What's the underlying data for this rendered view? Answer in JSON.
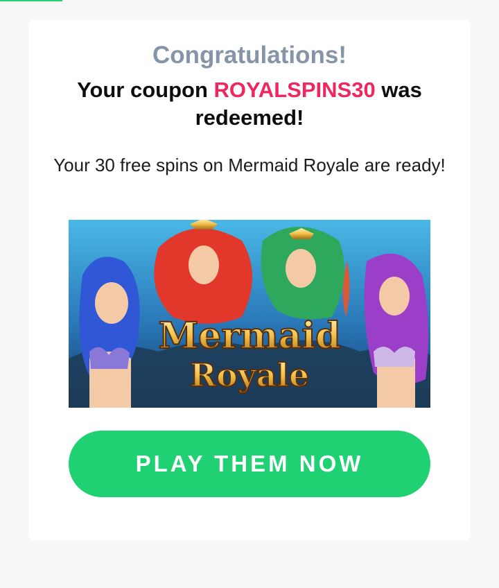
{
  "congrats": "Congratulations!",
  "headline": {
    "before": "Your coupon ",
    "code": "ROYALSPINS30",
    "after": " was redeemed!"
  },
  "subtext": "Your 30 free spins on Mermaid Royale are ready!",
  "game": {
    "logo_line1": "Mermaid",
    "logo_line2": "Royale"
  },
  "cta_label": "PLAY THEM NOW",
  "colors": {
    "accent_green": "#1fd172",
    "coupon_pink": "#f0265f",
    "congrats_gray": "#8594a6"
  }
}
